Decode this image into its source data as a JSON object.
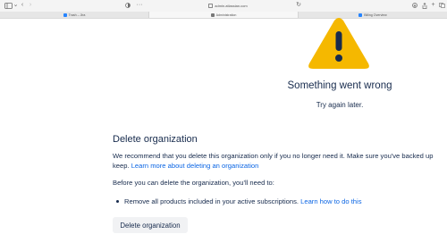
{
  "browser": {
    "url": "admin.atlassian.com",
    "tabs": [
      {
        "label": "Trash – Jira",
        "favicon_color": "#2684ff"
      },
      {
        "label": "Administration",
        "favicon_color": "#555555"
      },
      {
        "label": "Billing Overview",
        "favicon_color": "#2684ff"
      }
    ]
  },
  "error": {
    "title": "Something went wrong",
    "subtitle": "Try again later."
  },
  "delete_org": {
    "heading": "Delete organization",
    "recommend_text": "We recommend that you delete this organization only if you no longer need it. Make sure you've backed up",
    "keep_text": "keep. ",
    "learn_more_link": "Learn more about deleting an organization",
    "before_text": "Before you can delete the organization, you'll need to:",
    "requirement_text": "Remove all products included in your active subscriptions. ",
    "requirement_link": "Learn how to do this",
    "button_label": "Delete organization"
  },
  "colors": {
    "warning": "#f5b800",
    "link": "#0c66e4",
    "text": "#172b4d"
  }
}
